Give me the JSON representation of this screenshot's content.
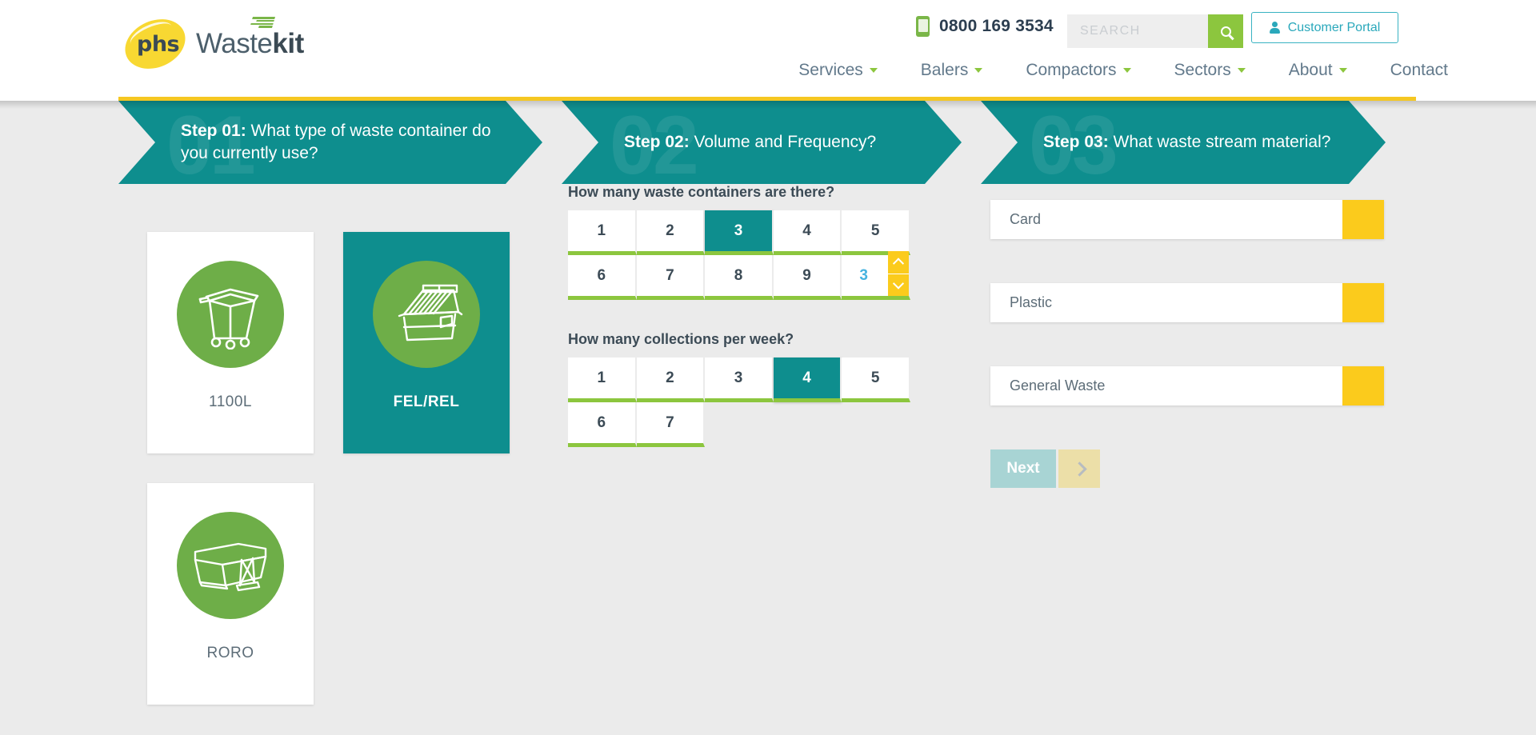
{
  "header": {
    "logo": {
      "mark": "phs",
      "word_light": "Waste",
      "word_bold": "kit"
    },
    "phone": "0800 169 3534",
    "search_placeholder": "SEARCH",
    "search_value": "",
    "portal_label": "Customer Portal",
    "nav": [
      {
        "label": "Services",
        "has_caret": true
      },
      {
        "label": "Balers",
        "has_caret": true
      },
      {
        "label": "Compactors",
        "has_caret": true
      },
      {
        "label": "Sectors",
        "has_caret": true
      },
      {
        "label": "About",
        "has_caret": true
      },
      {
        "label": "Contact",
        "has_caret": false
      }
    ]
  },
  "steps": [
    {
      "num": "01",
      "label": "Step 01:",
      "question": " What type of waste container do you currently use?"
    },
    {
      "num": "02",
      "label": "Step 02:",
      "question": " Volume and Frequency?"
    },
    {
      "num": "03",
      "label": "Step 03:",
      "question": " What waste stream material?"
    }
  ],
  "step1": {
    "cards": [
      {
        "label": "1100L",
        "icon": "wheelie-bin-icon",
        "selected": false
      },
      {
        "label": "FEL/REL",
        "icon": "front-end-loader-icon",
        "selected": true
      },
      {
        "label": "RORO",
        "icon": "roll-on-roll-off-icon",
        "selected": false
      }
    ]
  },
  "step2": {
    "containers": {
      "question": "How many waste containers are there?",
      "options": [
        "1",
        "2",
        "3",
        "4",
        "5",
        "6",
        "7",
        "8",
        "9"
      ],
      "selected": "3",
      "custom_value": "3"
    },
    "collections": {
      "question": "How many collections per week?",
      "options": [
        "1",
        "2",
        "3",
        "4",
        "5",
        "6",
        "7"
      ],
      "selected": "4"
    }
  },
  "step3": {
    "dropdowns": [
      {
        "value": "Card"
      },
      {
        "value": "Plastic"
      },
      {
        "value": "General Waste"
      }
    ],
    "next_label": "Next"
  },
  "colors": {
    "teal": "#0e8e8e",
    "green": "#8cc63e",
    "icon_green": "#6eae48",
    "yellow": "#fbcb1c",
    "rule_yellow": "#f5c722",
    "page_bg": "#ebebeb",
    "nav_text": "#62798b",
    "portal_teal": "#2aa8bb",
    "spin_blue": "#45b3e0"
  }
}
